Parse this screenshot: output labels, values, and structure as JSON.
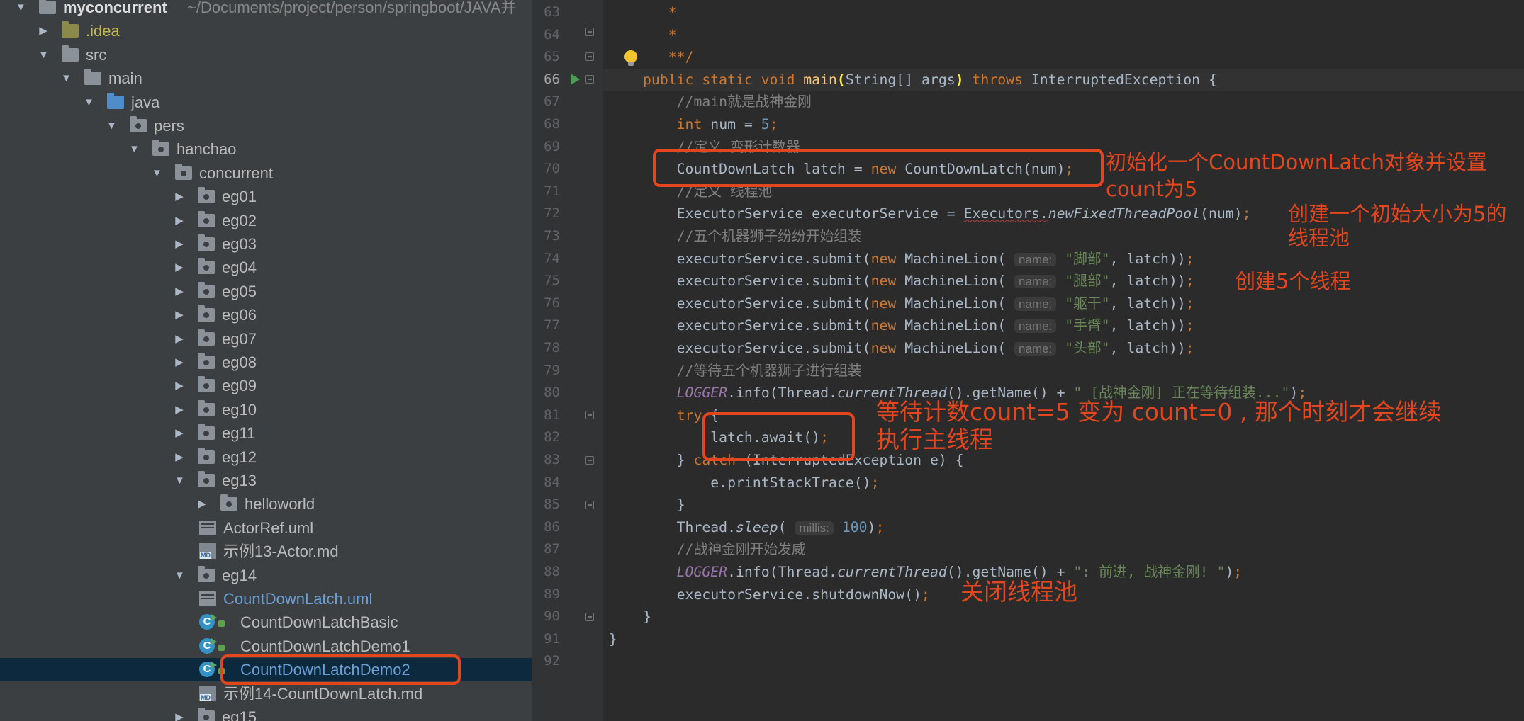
{
  "project": {
    "root_name": "myconcurrent",
    "root_path": "~/Documents/project/person/springboot/JAVA并",
    "items": [
      {
        "label": "myconcurrent",
        "depth": 0,
        "expanded": true,
        "type": "module"
      },
      {
        "label": ".idea",
        "depth": 1,
        "expanded": false,
        "type": "folder-gold"
      },
      {
        "label": "src",
        "depth": 1,
        "expanded": true,
        "type": "folder"
      },
      {
        "label": "main",
        "depth": 2,
        "expanded": true,
        "type": "folder"
      },
      {
        "label": "java",
        "depth": 3,
        "expanded": true,
        "type": "folder-blue"
      },
      {
        "label": "pers",
        "depth": 4,
        "expanded": true,
        "type": "package"
      },
      {
        "label": "hanchao",
        "depth": 5,
        "expanded": true,
        "type": "package"
      },
      {
        "label": "concurrent",
        "depth": 6,
        "expanded": true,
        "type": "package"
      },
      {
        "label": "eg01",
        "depth": 7,
        "expanded": false,
        "type": "package"
      },
      {
        "label": "eg02",
        "depth": 7,
        "expanded": false,
        "type": "package"
      },
      {
        "label": "eg03",
        "depth": 7,
        "expanded": false,
        "type": "package"
      },
      {
        "label": "eg04",
        "depth": 7,
        "expanded": false,
        "type": "package"
      },
      {
        "label": "eg05",
        "depth": 7,
        "expanded": false,
        "type": "package"
      },
      {
        "label": "eg06",
        "depth": 7,
        "expanded": false,
        "type": "package"
      },
      {
        "label": "eg07",
        "depth": 7,
        "expanded": false,
        "type": "package"
      },
      {
        "label": "eg08",
        "depth": 7,
        "expanded": false,
        "type": "package"
      },
      {
        "label": "eg09",
        "depth": 7,
        "expanded": false,
        "type": "package"
      },
      {
        "label": "eg10",
        "depth": 7,
        "expanded": false,
        "type": "package"
      },
      {
        "label": "eg11",
        "depth": 7,
        "expanded": false,
        "type": "package"
      },
      {
        "label": "eg12",
        "depth": 7,
        "expanded": false,
        "type": "package"
      },
      {
        "label": "eg13",
        "depth": 7,
        "expanded": true,
        "type": "package"
      },
      {
        "label": "helloworld",
        "depth": 8,
        "expanded": false,
        "type": "package"
      },
      {
        "label": "ActorRef.uml",
        "depth": 8,
        "type": "uml"
      },
      {
        "label": "示例13-Actor.md",
        "depth": 8,
        "type": "md"
      },
      {
        "label": "eg14",
        "depth": 7,
        "expanded": true,
        "type": "package"
      },
      {
        "label": "CountDownLatch.uml",
        "depth": 8,
        "type": "uml",
        "color": "blue"
      },
      {
        "label": "CountDownLatchBasic",
        "depth": 8,
        "type": "class"
      },
      {
        "label": "CountDownLatchDemo1",
        "depth": 8,
        "type": "class"
      },
      {
        "label": "CountDownLatchDemo2",
        "depth": 8,
        "type": "class",
        "selected": true,
        "color": "blue"
      },
      {
        "label": "示例14-CountDownLatch.md",
        "depth": 8,
        "type": "md"
      },
      {
        "label": "eg15",
        "depth": 7,
        "expanded": false,
        "type": "package"
      }
    ]
  },
  "editor": {
    "current_line": 66,
    "lines": [
      {
        "n": 63,
        "html": "   <span class=\"kw\">*</span>"
      },
      {
        "n": 64,
        "html": "   <span class=\"kw\">*</span>"
      },
      {
        "n": 65,
        "html": "   <span class=\"kw\">**/</span>"
      },
      {
        "n": 66,
        "html": "<span class=\"kw\">public static void </span><span class=\"fn\">main</span><span class=\"brk\">(</span>String[] args<span class=\"brk\">)</span> <span class=\"kw\">throws </span>InterruptedException {"
      },
      {
        "n": 67,
        "html": "    <span class=\"cm\">//main就是战神金刚</span>"
      },
      {
        "n": 68,
        "html": "    <span class=\"kw\">int </span>num = <span class=\"num\">5</span><span class=\"kw\">;</span>"
      },
      {
        "n": 69,
        "html": "    <span class=\"cm\">//定义 变形计数器</span>"
      },
      {
        "n": 70,
        "html": "    CountDownLatch latch = <span class=\"kw\">new </span>CountDownLatch(num)<span class=\"kw\">;</span>"
      },
      {
        "n": 71,
        "html": "    <span class=\"cm\">//定义 线程池</span>"
      },
      {
        "n": 72,
        "html": "    ExecutorService executorService = <span class=\"wavy\">Executors.</span><span class=\"it\">newFixedThreadPool</span>(num)<span class=\"kw\">;</span>"
      },
      {
        "n": 73,
        "html": "    <span class=\"cm\">//五个机器狮子纷纷开始组装</span>"
      },
      {
        "n": 74,
        "html": "    executorService.submit(<span class=\"kw\">new </span>MachineLion( <span class=\"hint\">name:</span> <span class=\"str\">\"脚部\"</span>, latch))<span class=\"kw\">;</span>"
      },
      {
        "n": 75,
        "html": "    executorService.submit(<span class=\"kw\">new </span>MachineLion( <span class=\"hint\">name:</span> <span class=\"str\">\"腿部\"</span>, latch))<span class=\"kw\">;</span>"
      },
      {
        "n": 76,
        "html": "    executorService.submit(<span class=\"kw\">new </span>MachineLion( <span class=\"hint\">name:</span> <span class=\"str\">\"躯干\"</span>, latch))<span class=\"kw\">;</span>"
      },
      {
        "n": 77,
        "html": "    executorService.submit(<span class=\"kw\">new </span>MachineLion( <span class=\"hint\">name:</span> <span class=\"str\">\"手臂\"</span>, latch))<span class=\"kw\">;</span>"
      },
      {
        "n": 78,
        "html": "    executorService.submit(<span class=\"kw\">new </span>MachineLion( <span class=\"hint\">name:</span> <span class=\"str\">\"头部\"</span>, latch))<span class=\"kw\">;</span>"
      },
      {
        "n": 79,
        "html": "    <span class=\"cm\">//等待五个机器狮子进行组装</span>"
      },
      {
        "n": 80,
        "html": "    <span class=\"st\">LOGGER</span>.info(Thread.<span class=\"it\">currentThread</span>().getName() + <span class=\"str\">\" [战神金刚] 正在等待组装...\"</span>)<span class=\"kw\">;</span>"
      },
      {
        "n": 81,
        "html": "    <span class=\"kw\">try </span>{"
      },
      {
        "n": 82,
        "html": "        latch.await()<span class=\"kw\">;</span>"
      },
      {
        "n": 83,
        "html": "    } <span class=\"kw\">catch </span>(InterruptedException e) {"
      },
      {
        "n": 84,
        "html": "        e.printStackTrace()<span class=\"kw\">;</span>"
      },
      {
        "n": 85,
        "html": "    }"
      },
      {
        "n": 86,
        "html": "    Thread.<span class=\"it\">sleep</span>( <span class=\"hint\">millis:</span> <span class=\"num\">100</span>)<span class=\"kw\">;</span>"
      },
      {
        "n": 87,
        "html": "    <span class=\"cm\">//战神金刚开始发威</span>"
      },
      {
        "n": 88,
        "html": "    <span class=\"st\">LOGGER</span>.info(Thread.<span class=\"it\">currentThread</span>().getName() + <span class=\"str\">\": 前进, 战神金刚! \"</span>)<span class=\"kw\">;</span>"
      },
      {
        "n": 89,
        "html": "    executorService.shutdownNow()<span class=\"kw\">;</span>"
      },
      {
        "n": 90,
        "html": "}"
      },
      {
        "n": 91,
        "html": "<span style=\"margin-left:-48px\">}</span>"
      },
      {
        "n": 92,
        "html": ""
      }
    ]
  },
  "annotations": {
    "init_latch": "初始化一个CountDownLatch对象并设置",
    "init_latch_2": "count为5",
    "create_pool": "创建一个初始大小为5的",
    "create_pool_2": "线程池",
    "create_threads": "创建5个线程",
    "await_1": "等待计数count=5 变为 count=0 , 那个时刻才会继续",
    "await_2": "执行主线程",
    "shutdown": "关闭线程池"
  },
  "colors": {
    "accent_red": "#e4461d",
    "keyword": "#cc7832",
    "string": "#6a8759",
    "comment": "#808080",
    "number": "#6897bb"
  }
}
